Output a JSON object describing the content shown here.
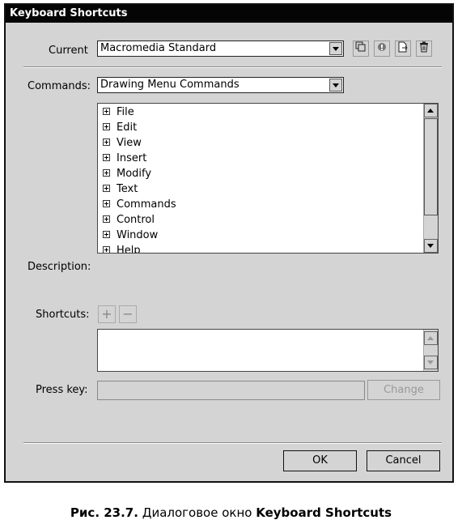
{
  "window": {
    "title": "Keyboard Shortcuts"
  },
  "current": {
    "label": "Current",
    "value": "Macromedia Standard"
  },
  "toolbar_icons": [
    "duplicate-set-icon",
    "rename-set-icon",
    "export-html-icon",
    "delete-set-icon"
  ],
  "commands": {
    "label": "Commands:",
    "value": "Drawing Menu Commands",
    "items": [
      "File",
      "Edit",
      "View",
      "Insert",
      "Modify",
      "Text",
      "Commands",
      "Control",
      "Window",
      "Help"
    ]
  },
  "description": {
    "label": "Description:"
  },
  "shortcuts": {
    "label": "Shortcuts:",
    "add": "+",
    "remove": "−"
  },
  "press_key": {
    "label": "Press key:",
    "change_button": "Change"
  },
  "buttons": {
    "ok": "OK",
    "cancel": "Cancel"
  },
  "caption": {
    "prefix": "Рис. 23.7.",
    "text": " Диалоговое окно ",
    "bold": "Keyboard Shortcuts"
  }
}
